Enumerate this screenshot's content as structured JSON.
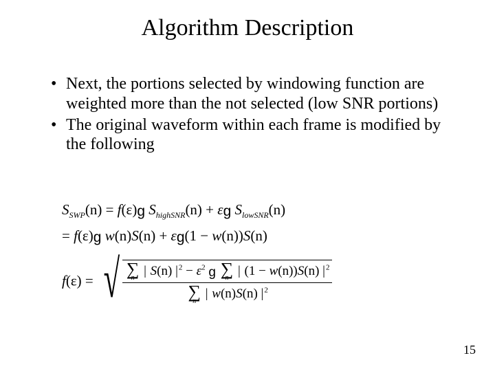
{
  "title": "Algorithm Description",
  "bullets": [
    "Next, the portions selected by windowing function are weighted more than the not selected (low SNR portions)",
    "The original waveform within each frame is modified by the following"
  ],
  "eq": {
    "line1": {
      "lhs_S": "S",
      "lhs_sub": "SWP",
      "lhs_arg": "(n) = ",
      "f": "f",
      "eps_arg": "(ε)",
      "g1": "g",
      "S_high": "S",
      "S_high_sub": "highSNR",
      "S_high_arg": "(n) + ",
      "eps": "ε",
      "g2": "g",
      "S_low": "S",
      "S_low_sub": "lowSNR",
      "S_low_arg": "(n)"
    },
    "line2": {
      "eq": "= ",
      "f": "f",
      "eps_arg": "(ε)",
      "g1": "g",
      "w": "w",
      "w_arg": "(n)",
      "S": "S",
      "S_arg": "(n) + ",
      "eps": "ε",
      "g2": "g",
      "open": "(1 − ",
      "w2": "w",
      "w2_arg": "(n))",
      "S2": "S",
      "S2_arg": "(n)"
    },
    "line3": {
      "f": "f",
      "eps_arg": "(ε) = ",
      "num_term1_S": "S",
      "num_term1_arg": "(n)",
      "minus": " − ",
      "eps2": "ε",
      "g": "g",
      "num_term2_open": "(1 − ",
      "num_term2_w": "w",
      "num_term2_warg": "(n))",
      "num_term2_S": "S",
      "num_term2_Sarg": "(n)",
      "den_w": "w",
      "den_warg": "(n)",
      "den_S": "S",
      "den_Sarg": "(n)",
      "sq": "2",
      "sigma_idx": "n",
      "bar": "|"
    }
  },
  "page_number": "15"
}
